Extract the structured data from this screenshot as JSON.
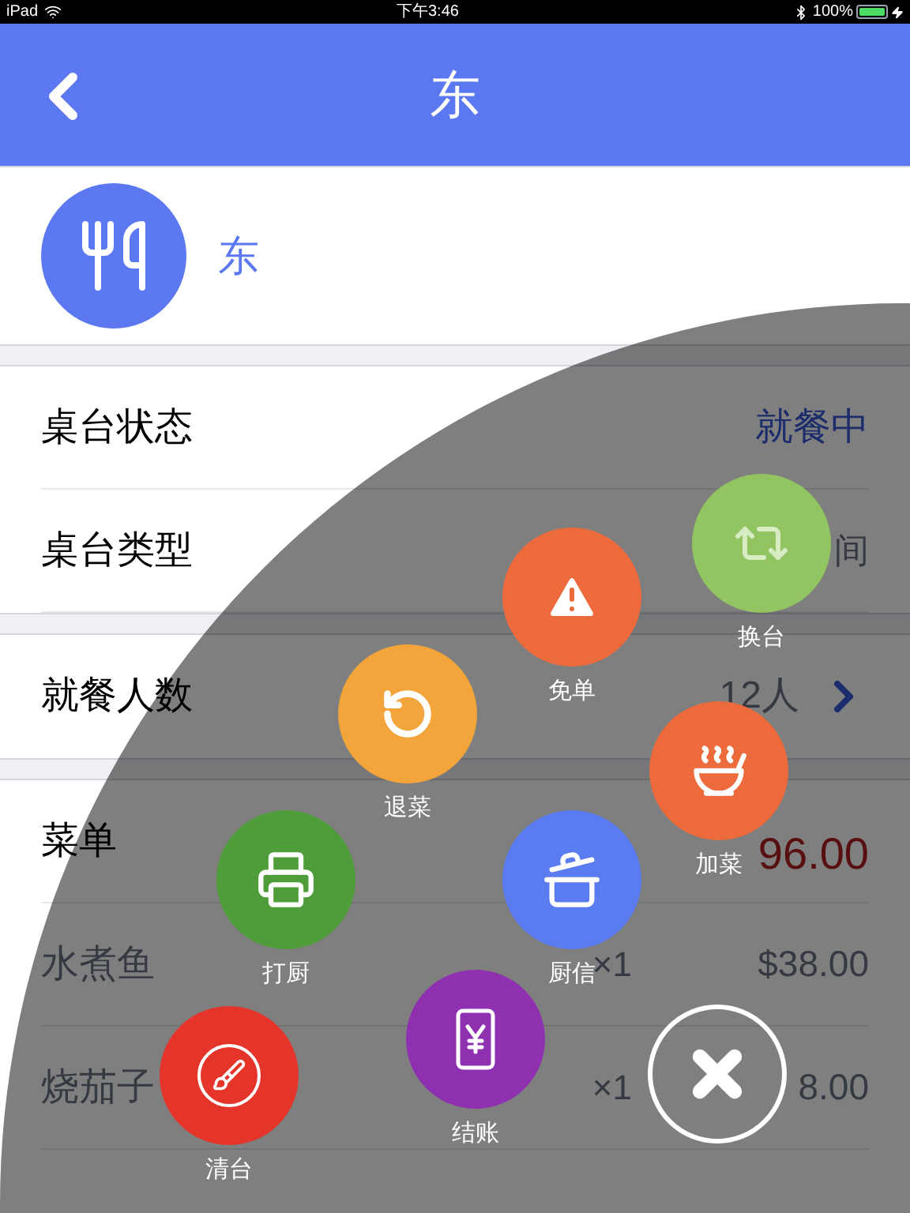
{
  "status_bar": {
    "carrier": "iPad",
    "time": "下午3:46",
    "battery": "100%"
  },
  "nav": {
    "title": "东"
  },
  "header": {
    "name": "东"
  },
  "info_rows": [
    {
      "label": "桌台状态",
      "value": "就餐中",
      "kind": "status"
    },
    {
      "label": "桌台类型",
      "value": "间",
      "kind": "plain"
    }
  ],
  "guests": {
    "label": "就餐人数",
    "value": "12人"
  },
  "menu": {
    "label": "菜单",
    "total": "96.00",
    "items": [
      {
        "name": "水煮鱼",
        "qty": "×1",
        "price": "$38.00"
      },
      {
        "name": "烧茄子",
        "qty": "×1",
        "price": "8.00"
      }
    ]
  },
  "actions": [
    {
      "label": "换台",
      "color": "#93c462"
    },
    {
      "label": "免单",
      "color": "#ec6a3b"
    },
    {
      "label": "退菜",
      "color": "#f3a43b"
    },
    {
      "label": "加菜",
      "color": "#ec6a3b"
    },
    {
      "label": "打厨",
      "color": "#4f9d3a"
    },
    {
      "label": "厨信",
      "color": "#5b7bf0"
    },
    {
      "label": "清台",
      "color": "#e5352b"
    },
    {
      "label": "结账",
      "color": "#8f30b1"
    }
  ]
}
